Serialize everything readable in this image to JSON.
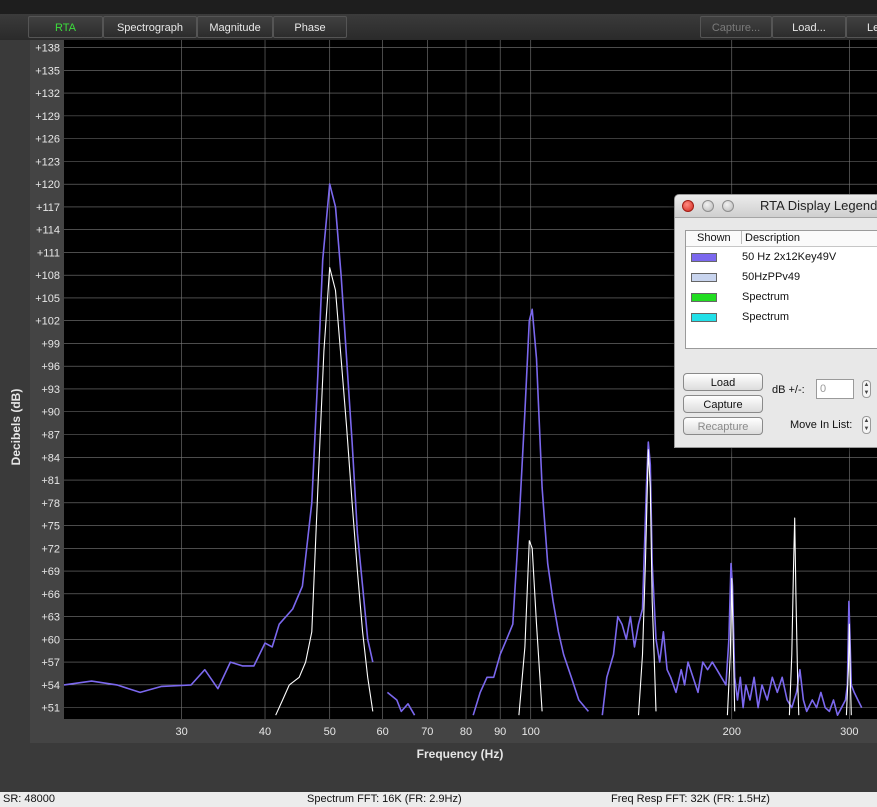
{
  "toolbar": {
    "tabs": [
      {
        "label": "RTA",
        "state": "active"
      },
      {
        "label": "Spectrograph",
        "state": "normal"
      },
      {
        "label": "Magnitude",
        "state": "normal"
      },
      {
        "label": "Phase",
        "state": "normal"
      }
    ],
    "capture_label": "Capture...",
    "load_label": "Load...",
    "legend_label": "Le"
  },
  "status_bar": {
    "sample_rate": "SR: 48000",
    "spectrum_fft": "Spectrum FFT: 16K (FR: 2.9Hz)",
    "freq_resp_fft": "Freq Resp FFT: 32K (FR: 1.5Hz)"
  },
  "legend_window": {
    "title": "RTA Display Legend",
    "col_shown": "Shown",
    "col_description": "Description",
    "items": [
      {
        "description": "50 Hz 2x12Key49V",
        "color": "#7b68ee"
      },
      {
        "description": "50HzPPv49",
        "color": "#c8d4ee"
      },
      {
        "description": "Spectrum",
        "color": "#22dd22"
      },
      {
        "description": "Spectrum",
        "color": "#22e0e8"
      }
    ],
    "load_button": "Load",
    "capture_button": "Capture",
    "recapture_button": "Recapture",
    "db_label": "dB +/-:",
    "db_value": "0",
    "move_label": "Move In List:"
  },
  "chart_data": {
    "type": "line",
    "xlabel": "Frequency (Hz)",
    "ylabel": "Decibels (dB)",
    "x_scale": "log",
    "xlim": [
      20,
      330
    ],
    "ylim": [
      49.5,
      139
    ],
    "x_ticks": [
      30,
      40,
      50,
      60,
      70,
      80,
      90,
      100,
      200,
      300
    ],
    "y_ticks": [
      "+51",
      "+54",
      "+57",
      "+60",
      "+63",
      "+66",
      "+69",
      "+72",
      "+75",
      "+78",
      "+81",
      "+84",
      "+87",
      "+90",
      "+93",
      "+96",
      "+99",
      "+102",
      "+105",
      "+108",
      "+111",
      "+114",
      "+117",
      "+120",
      "+123",
      "+126",
      "+129",
      "+132",
      "+135",
      "+138"
    ],
    "grid": true,
    "background": "#000000",
    "series": [
      {
        "name": "50 Hz 2x12Key49V",
        "color": "#7b68ee",
        "segments": [
          [
            [
              20,
              54
            ],
            [
              22,
              54.5
            ],
            [
              24,
              54
            ],
            [
              26,
              53
            ],
            [
              28,
              53.8
            ],
            [
              31,
              54
            ],
            [
              32.5,
              56
            ],
            [
              34,
              53.5
            ],
            [
              35.5,
              57
            ],
            [
              37,
              56.5
            ],
            [
              38.5,
              56.5
            ],
            [
              40,
              59.5
            ],
            [
              41,
              59
            ],
            [
              42,
              62
            ],
            [
              44,
              64
            ],
            [
              45.5,
              67
            ],
            [
              47,
              78
            ],
            [
              48,
              95
            ],
            [
              48.8,
              110
            ],
            [
              50,
              120
            ],
            [
              51,
              117
            ],
            [
              52,
              108
            ],
            [
              53,
              97
            ],
            [
              54,
              86
            ],
            [
              55,
              74
            ],
            [
              56,
              67
            ],
            [
              57,
              60
            ],
            [
              58,
              57
            ]
          ],
          [
            [
              61,
              53
            ],
            [
              63,
              52
            ],
            [
              64,
              50.5
            ],
            [
              65.5,
              51.5
            ],
            [
              67,
              50
            ]
          ],
          [
            [
              82,
              50
            ],
            [
              84,
              53
            ],
            [
              86,
              55
            ],
            [
              88,
              55
            ],
            [
              90,
              58
            ],
            [
              92,
              60
            ],
            [
              94,
              62
            ],
            [
              96,
              75
            ],
            [
              98,
              90
            ],
            [
              99.5,
              102
            ],
            [
              100.5,
              103.5
            ],
            [
              102,
              97
            ],
            [
              104,
              80
            ],
            [
              106,
              70
            ],
            [
              108,
              65
            ],
            [
              110,
              61
            ],
            [
              112,
              58
            ],
            [
              115,
              55
            ],
            [
              118,
              52
            ],
            [
              122,
              50.5
            ]
          ],
          [
            [
              128,
              50
            ],
            [
              130,
              55
            ],
            [
              133,
              58
            ],
            [
              135,
              63
            ],
            [
              137,
              62
            ],
            [
              139,
              60
            ],
            [
              141,
              63
            ],
            [
              143,
              59
            ],
            [
              145,
              62
            ],
            [
              147,
              64
            ],
            [
              149,
              80
            ],
            [
              150,
              86
            ],
            [
              151,
              83
            ],
            [
              152,
              70
            ],
            [
              154,
              60
            ],
            [
              156,
              57
            ],
            [
              158,
              61
            ],
            [
              160,
              56
            ],
            [
              162,
              55
            ],
            [
              165,
              53
            ],
            [
              168,
              56
            ],
            [
              170,
              54
            ],
            [
              172,
              57
            ],
            [
              175,
              55
            ],
            [
              178,
              53
            ],
            [
              181,
              57
            ],
            [
              184,
              56
            ],
            [
              187,
              57
            ],
            [
              190,
              56
            ],
            [
              193,
              55
            ],
            [
              196,
              54
            ],
            [
              198,
              60
            ],
            [
              199.5,
              70
            ],
            [
              200.5,
              67
            ],
            [
              202,
              55
            ],
            [
              204,
              52
            ],
            [
              206,
              55
            ],
            [
              208,
              51
            ],
            [
              210,
              54
            ],
            [
              213,
              52
            ],
            [
              216,
              55
            ],
            [
              219,
              51
            ],
            [
              222,
              54
            ],
            [
              226,
              52
            ],
            [
              230,
              55
            ],
            [
              234,
              53
            ],
            [
              238,
              55
            ],
            [
              242,
              52
            ],
            [
              246,
              51
            ],
            [
              250,
              53
            ],
            [
              253,
              56
            ],
            [
              256,
              52
            ],
            [
              259,
              50.5
            ],
            [
              264,
              52
            ],
            [
              268,
              51
            ],
            [
              272,
              53
            ],
            [
              276,
              51
            ],
            [
              280,
              50.5
            ],
            [
              284,
              52
            ],
            [
              288,
              50
            ],
            [
              292,
              51
            ],
            [
              296,
              52
            ],
            [
              298,
              54
            ],
            [
              299.5,
              65
            ],
            [
              300.5,
              61
            ],
            [
              302,
              54
            ],
            [
              305,
              53
            ],
            [
              309,
              52
            ],
            [
              313,
              51
            ]
          ]
        ]
      },
      {
        "name": "50HzPPv49",
        "color": "#ffffff",
        "segments": [
          [
            [
              41.5,
              50
            ],
            [
              42.5,
              52
            ],
            [
              43.5,
              54
            ],
            [
              45,
              55
            ],
            [
              46,
              57
            ],
            [
              47,
              61
            ],
            [
              48,
              80
            ],
            [
              49,
              98
            ],
            [
              50,
              109
            ],
            [
              51,
              106
            ],
            [
              52,
              97
            ],
            [
              53,
              88
            ],
            [
              54,
              78
            ],
            [
              55,
              69
            ],
            [
              56,
              61
            ],
            [
              57,
              55
            ],
            [
              58,
              50.5
            ]
          ],
          [
            [
              96,
              50
            ],
            [
              98,
              59
            ],
            [
              99.5,
              73
            ],
            [
              100.5,
              72
            ],
            [
              102,
              62
            ],
            [
              104,
              50.5
            ]
          ],
          [
            [
              145,
              50
            ],
            [
              147,
              58
            ],
            [
              148.5,
              70
            ],
            [
              150,
              85
            ],
            [
              151,
              80
            ],
            [
              152,
              65
            ],
            [
              153,
              58
            ],
            [
              154,
              50.5
            ]
          ],
          [
            [
              197,
              50
            ],
            [
              199,
              58
            ],
            [
              200,
              68
            ],
            [
              201,
              60
            ],
            [
              202,
              50.5
            ]
          ],
          [
            [
              244,
              50
            ],
            [
              246,
              58
            ],
            [
              247.5,
              70
            ],
            [
              248.5,
              76
            ],
            [
              249.5,
              66
            ],
            [
              251,
              55
            ],
            [
              252,
              50
            ]
          ],
          [
            [
              297,
              50
            ],
            [
              299,
              56
            ],
            [
              300,
              62
            ],
            [
              301,
              55
            ],
            [
              302,
              50
            ]
          ]
        ]
      }
    ]
  }
}
